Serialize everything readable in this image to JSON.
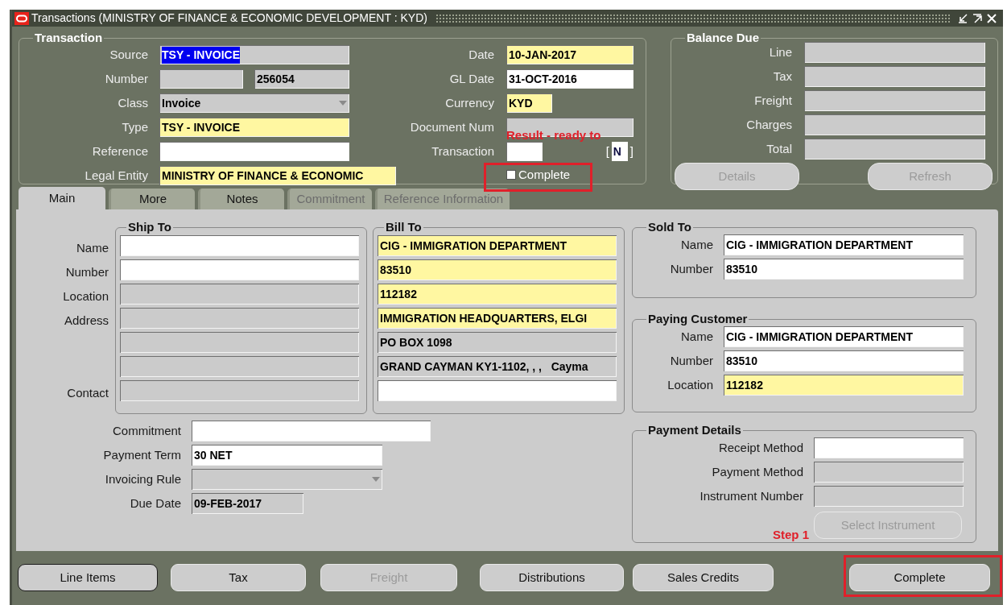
{
  "window": {
    "title": "Transactions (MINISTRY OF FINANCE & ECONOMIC DEVELOPMENT : KYD)"
  },
  "transaction": {
    "legend": "Transaction",
    "left_fields": [
      {
        "label": "Source",
        "kind": "readonly",
        "value": "TSY - INVOICE",
        "highlighted": true
      },
      {
        "label": "Number",
        "kind": "readonly",
        "value": "256054"
      },
      {
        "label": "Class",
        "kind": "readonly",
        "value": "Invoice",
        "dropdown": true
      },
      {
        "label": "Type",
        "kind": "required",
        "value": "TSY - INVOICE"
      },
      {
        "label": "Reference",
        "kind": "editable"
      },
      {
        "label": "Legal Entity",
        "kind": "required",
        "value": "MINISTRY OF FINANCE & ECONOMIC"
      }
    ],
    "right_fields": [
      {
        "label": "Date",
        "kind": "required",
        "value": "10-JAN-2017"
      },
      {
        "label": "GL Date",
        "kind": "editable",
        "value": "31-OCT-2016"
      },
      {
        "label": "Currency",
        "kind": "required",
        "value": "KYD"
      },
      {
        "label": "Document Num",
        "kind": "readonly"
      },
      {
        "label": "Transaction",
        "kind": "editable",
        "flag_open": "[",
        "flag_value": "N",
        "flag_close": "]"
      }
    ],
    "complete_checkbox": {
      "label": "Complete",
      "checked": false
    }
  },
  "balance_due": {
    "legend": "Balance Due",
    "fields": [
      {
        "label": "Line",
        "kind": "readonly"
      },
      {
        "label": "Tax",
        "kind": "readonly"
      },
      {
        "label": "Freight",
        "kind": "readonly"
      },
      {
        "label": "Charges",
        "kind": "readonly"
      },
      {
        "label": "Total",
        "kind": "readonly"
      }
    ],
    "buttons": [
      {
        "label": "Details",
        "disabled": true
      },
      {
        "label": "Refresh",
        "disabled": true
      }
    ]
  },
  "tabs": [
    {
      "label": "Main",
      "selected": true,
      "disabled": false
    },
    {
      "label": "More",
      "selected": false,
      "disabled": false
    },
    {
      "label": "Notes",
      "selected": false,
      "disabled": false
    },
    {
      "label": "Commitment",
      "selected": false,
      "disabled": true
    },
    {
      "label": "Reference Information",
      "selected": false,
      "disabled": true
    }
  ],
  "ship_to": {
    "legend": "Ship To",
    "fields": [
      {
        "label": "Name",
        "kind": "editable"
      },
      {
        "label": "Number",
        "kind": "editable"
      },
      {
        "label": "Location",
        "kind": "readonly"
      },
      {
        "label": "Address",
        "kind": "readonly"
      },
      {
        "kind": "readonly"
      },
      {
        "kind": "readonly"
      },
      {
        "label": "Contact",
        "kind": "readonly"
      }
    ]
  },
  "bill_to": {
    "legend": "Bill To",
    "fields": [
      {
        "kind": "required",
        "value": "CIG - IMMIGRATION DEPARTMENT"
      },
      {
        "kind": "required",
        "value": "83510"
      },
      {
        "kind": "required",
        "value": "112182"
      },
      {
        "kind": "required",
        "value": "IMMIGRATION HEADQUARTERS, ELGI"
      },
      {
        "kind": "readonly",
        "value": "PO BOX 1098"
      },
      {
        "kind": "readonly",
        "value": "GRAND CAYMAN KY1-1102, , ,   Cayma"
      },
      {
        "kind": "editable"
      }
    ]
  },
  "sold_to": {
    "legend": "Sold To",
    "fields": [
      {
        "label": "Name",
        "kind": "editable",
        "value": "CIG - IMMIGRATION DEPARTMENT"
      },
      {
        "label": "Number",
        "kind": "editable",
        "value": "83510"
      }
    ]
  },
  "paying_customer": {
    "legend": "Paying Customer",
    "fields": [
      {
        "label": "Name",
        "kind": "editable",
        "value": "CIG - IMMIGRATION DEPARTMENT"
      },
      {
        "label": "Number",
        "kind": "editable",
        "value": "83510"
      },
      {
        "label": "Location",
        "kind": "required",
        "value": "112182"
      }
    ]
  },
  "payment_details": {
    "legend": "Payment Details",
    "fields": [
      {
        "label": "Receipt Method",
        "kind": "editable"
      },
      {
        "label": "Payment Method",
        "kind": "readonly"
      },
      {
        "label": "Instrument Number",
        "kind": "readonly"
      }
    ],
    "button": {
      "label": "Select Instrument",
      "disabled": true
    }
  },
  "terms": [
    {
      "label": "Commitment",
      "kind": "editable"
    },
    {
      "label": "Payment Term",
      "kind": "editable",
      "value": "30 NET"
    },
    {
      "label": "Invoicing Rule",
      "kind": "readonly",
      "dropdown": true
    },
    {
      "label": "Due Date",
      "kind": "readonly",
      "value": "09-FEB-2017"
    }
  ],
  "buttons": [
    {
      "label": "Line Items",
      "disabled": false,
      "default": true
    },
    {
      "label": "Tax",
      "disabled": false,
      "default": false
    },
    {
      "label": "Freight",
      "disabled": true,
      "default": false
    },
    {
      "label": "Distributions",
      "disabled": false,
      "default": false
    },
    {
      "label": "Sales Credits",
      "disabled": false,
      "default": false
    },
    {
      "label": "Complete",
      "disabled": false,
      "default": false
    }
  ],
  "annotations": [
    {
      "text": "Result - ready to"
    },
    {
      "text": "Step 1"
    }
  ]
}
